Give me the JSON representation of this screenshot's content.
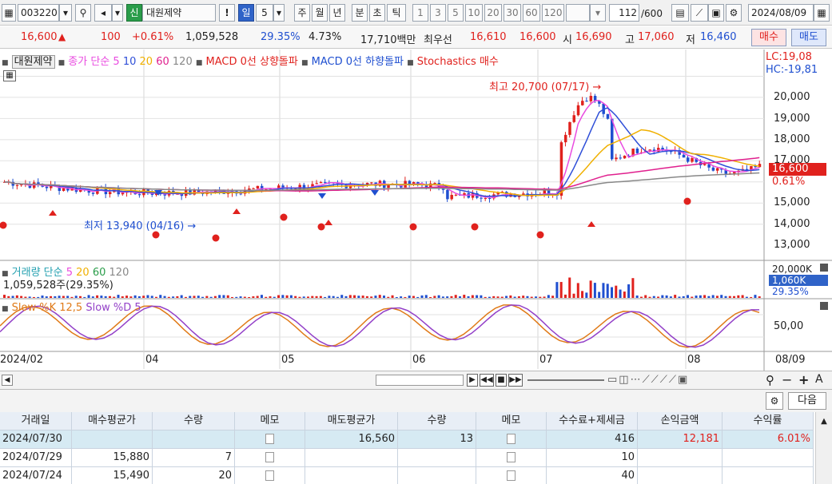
{
  "toolbar": {
    "stock_code": "003220",
    "market_badge": "신",
    "stock_name": "대원제약",
    "period_buttons": [
      "일",
      "5"
    ],
    "period_types": [
      "주",
      "월",
      "년",
      "분",
      "초",
      "틱"
    ],
    "interval_buttons": [
      "1",
      "3",
      "5",
      "10",
      "20",
      "30",
      "60",
      "120"
    ],
    "count_value": "112",
    "count_total": "/600",
    "date": "2024/08/09"
  },
  "quote": {
    "price": "16,600",
    "change": "100",
    "change_pct": "+0.61%",
    "volume": "1,059,528",
    "vol_ratio": "29.35%",
    "turnover": "4.73%",
    "amount": "17,710백만",
    "best_label": "최우선",
    "best_ask": "16,610",
    "best_bid": "16,600",
    "open_label": "시",
    "open": "16,690",
    "high_label": "고",
    "high": "17,060",
    "low_label": "저",
    "low": "16,460",
    "buy_button": "매수",
    "sell_button": "매도"
  },
  "price_legend": {
    "stock": "대원제약",
    "ma_title": "종가 단순",
    "ma_periods": [
      "5",
      "10",
      "20",
      "60",
      "120"
    ],
    "macd_up": "MACD 0선 상향돌파",
    "macd_down": "MACD 0선 하향돌파",
    "stoch_sig": "Stochastics 매수"
  },
  "annotations": {
    "high": "최고 20,700 (07/17) →",
    "low": "최저 13,940 (04/16) →",
    "lc": "LC:19,08",
    "hc": "HC:-19,81",
    "price_tag": "16,600",
    "pct_tag": "0.61%",
    "vol_tag": "1,060K",
    "vol_pct": "29.35%",
    "vol_top": "20,000K",
    "stoch_level": "50,00"
  },
  "price_axis": [
    "20,000",
    "19,000",
    "18,000",
    "17,000",
    "15,000",
    "14,000",
    "13,000"
  ],
  "volume_legend": {
    "title": "거래량 단순",
    "periods": [
      "5",
      "20",
      "60",
      "120"
    ],
    "current": "1,059,528주(29.35%)"
  },
  "stoch_legend": {
    "k": "Slow %K 12,5",
    "d": "Slow %D 5"
  },
  "x_axis": [
    "2024/02",
    "04",
    "05",
    "06",
    "07",
    "08",
    "08/09"
  ],
  "grid": {
    "next_button": "다음",
    "headers": [
      "거래일",
      "매수평균가",
      "수량",
      "메모",
      "매도평균가",
      "수량",
      "메모",
      "수수료+제세금",
      "손익금액",
      "수익률"
    ],
    "rows": [
      [
        "2024/07/30",
        "",
        "",
        "",
        "16,560",
        "13",
        "",
        "416",
        "12,181",
        "6.01%"
      ],
      [
        "2024/07/29",
        "15,880",
        "7",
        "",
        "",
        "",
        "",
        "10",
        "",
        ""
      ],
      [
        "2024/07/24",
        "15,490",
        "20",
        "",
        "",
        "",
        "",
        "40",
        "",
        ""
      ]
    ]
  },
  "colors": {
    "up": "#e0211d",
    "down": "#1f4fd0",
    "ma5": "#e94be0",
    "ma10": "#2f4fd8",
    "ma20": "#f0b000",
    "ma60": "#e0208e",
    "ma120": "#888888",
    "stoch_k": "#e07a18",
    "stoch_d": "#9340c8"
  }
}
